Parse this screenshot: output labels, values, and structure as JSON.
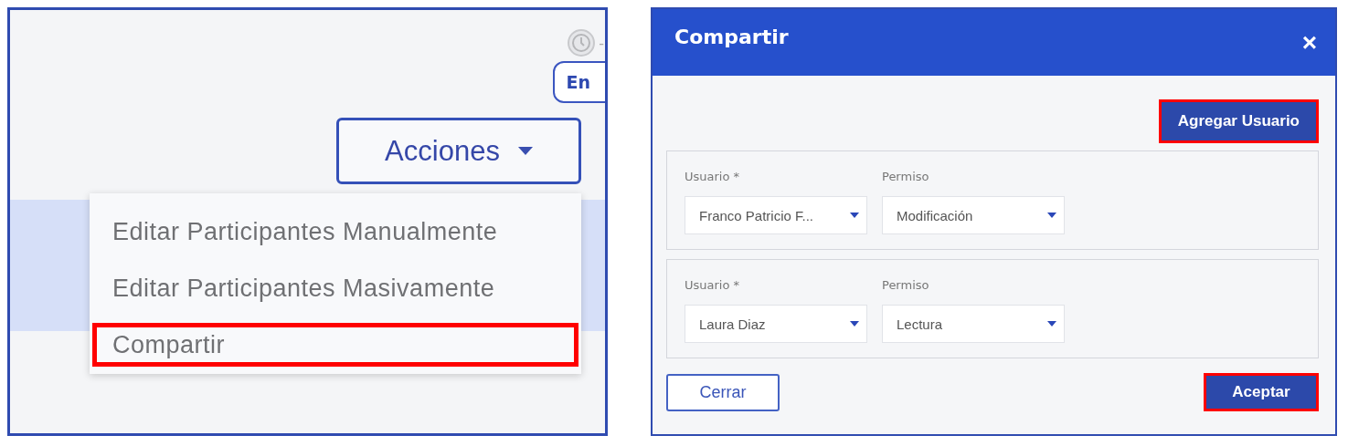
{
  "left_panel": {
    "time_text": "-",
    "status_badge": "En",
    "actions_button": "Acciones",
    "menu": {
      "items": [
        {
          "label": "Editar Participantes Manualmente",
          "highlighted": false
        },
        {
          "label": "Editar Participantes Masivamente",
          "highlighted": false
        },
        {
          "label": "Compartir",
          "highlighted": true
        }
      ]
    }
  },
  "dialog": {
    "title": "Compartir",
    "close": "×",
    "add_button": {
      "label": "Agregar Usuario",
      "highlighted": true
    },
    "entries": [
      {
        "user_label": "Usuario *",
        "user": "Franco Patricio F...",
        "permission_label": "Permiso",
        "permission": "Modificación"
      },
      {
        "user_label": "Usuario *",
        "user": "Laura Diaz",
        "permission_label": "Permiso",
        "permission": "Lectura"
      }
    ],
    "buttons": [
      {
        "label": "Cerrar",
        "kind": "secondary",
        "highlighted": false
      },
      {
        "label": "Aceptar",
        "kind": "primary",
        "highlighted": true
      }
    ]
  }
}
